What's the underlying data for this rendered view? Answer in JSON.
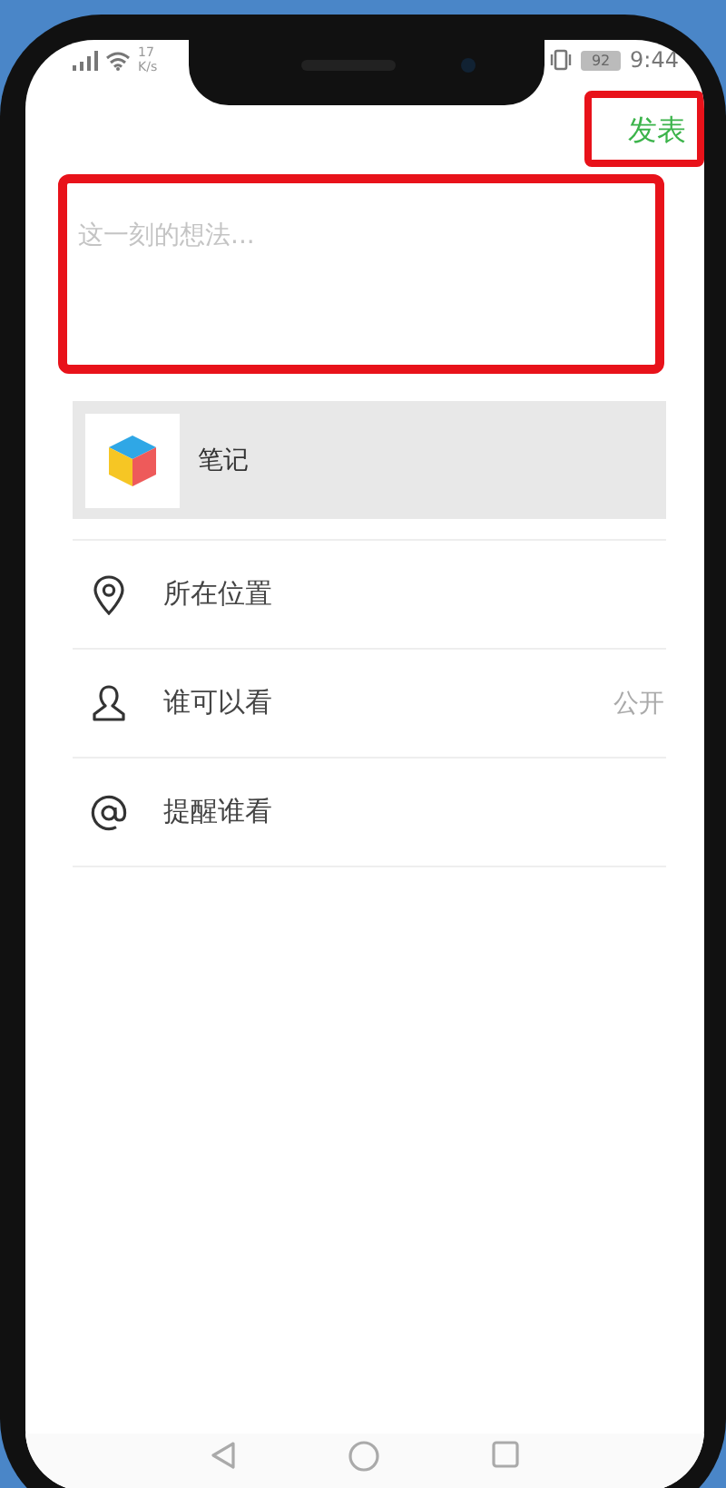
{
  "status_bar": {
    "network_speed": "17",
    "network_unit": "K/s",
    "battery": "92",
    "time": "9:44"
  },
  "post_button": {
    "label": "发表",
    "highlighted": true
  },
  "text_field": {
    "placeholder": "这一刻的想法...",
    "highlighted": true
  },
  "attachment": {
    "label": "笔记"
  },
  "options": [
    {
      "kind": "location",
      "label": "所在位置"
    },
    {
      "kind": "visibility",
      "label": "谁可以看",
      "value": "公开"
    },
    {
      "kind": "mention",
      "label": "提醒谁看"
    }
  ]
}
